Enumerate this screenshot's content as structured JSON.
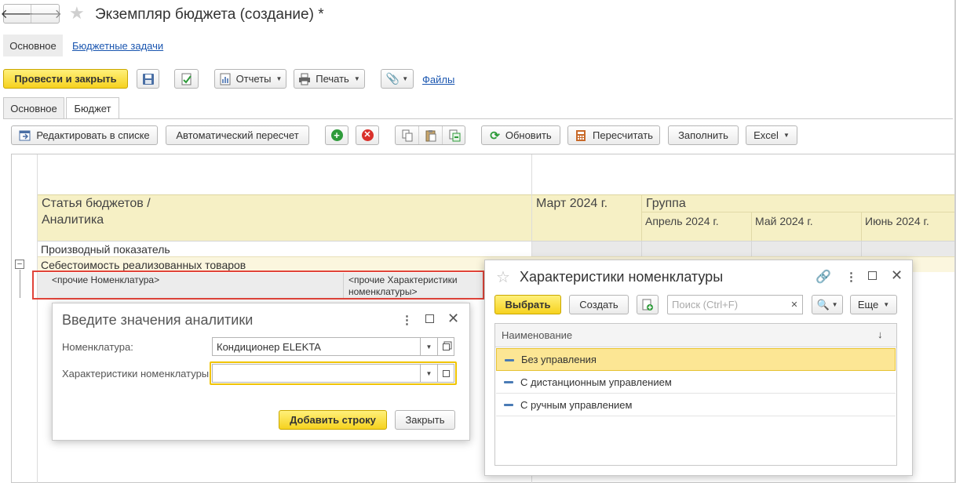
{
  "window": {
    "title": "Экземпляр бюджета (создание) *"
  },
  "nav": {
    "main": "Основное",
    "tasks": "Бюджетные задачи"
  },
  "toolbar": {
    "post_close": "Провести и закрыть",
    "reports": "Отчеты",
    "print": "Печать",
    "files": "Файлы"
  },
  "tabs": {
    "main": "Основное",
    "budget": "Бюджет"
  },
  "table_toolbar": {
    "edit_list": "Редактировать в списке",
    "auto_recalc": "Автоматический пересчет",
    "refresh": "Обновить",
    "recalc": "Пересчитать",
    "fill": "Заполнить",
    "excel": "Excel"
  },
  "grid": {
    "col_article_line1": "Статья бюджетов /",
    "col_article_line2": "Аналитика",
    "col_march": "Март 2024 г.",
    "col_group": "Группа",
    "col_april": "Апрель 2024 г.",
    "col_may": "Май 2024 г.",
    "col_june": "Июнь 2024 г.",
    "row1": "Производный показатель",
    "row2": "Себестоимость реализованных товаров",
    "row3_nom": "<прочие Номенклатура>",
    "row3_char_line1": "<прочие Характеристики",
    "row3_char_line2": "номенклатуры>"
  },
  "dialog_analytics": {
    "title": "Введите значения аналитики",
    "nom_label": "Номенклатура:",
    "nom_value": "Кондиционер ELEKTA",
    "char_label": "Характеристики номенклатуры:",
    "char_value": "",
    "add_row": "Добавить строку",
    "close": "Закрыть"
  },
  "dialog_char": {
    "title": "Характеристики номенклатуры",
    "select": "Выбрать",
    "create": "Создать",
    "search_placeholder": "Поиск (Ctrl+F)",
    "more": "Еще",
    "col_name": "Наименование",
    "sort_arrow": "↓",
    "items": [
      "Без управления",
      "С дистанционным управлением",
      "С ручным управлением"
    ]
  },
  "colors": {
    "accent_yellow": "#f6d21f",
    "header_yellow": "#f6f0c5",
    "highlight_red": "#e0443a",
    "link": "#1a56b0"
  }
}
